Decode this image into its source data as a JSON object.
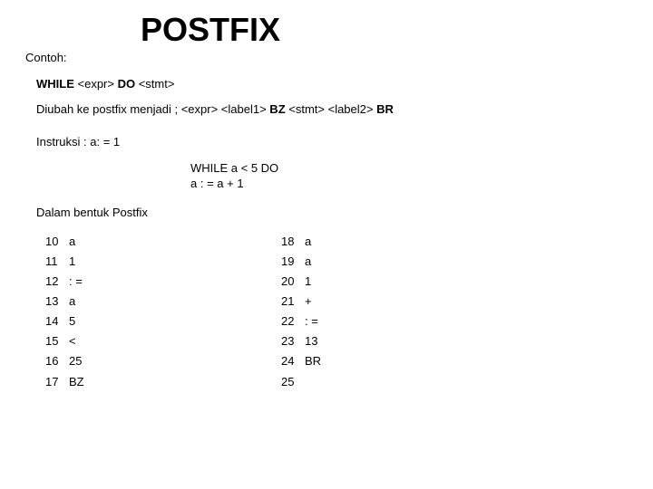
{
  "title": "POSTFIX",
  "contoh_label": "Contoh:",
  "line_while": {
    "pre": "WHILE",
    "mid": " <expr> ",
    "do": "DO",
    "post": " <stmt>"
  },
  "line_transform": {
    "prefix": "Diubah ke postfix menjadi ;",
    "spacer": "    ",
    "part1": "<expr>  <label1>",
    "bz": " BZ ",
    "part2": "<stmt> <label2>",
    "br": " BR"
  },
  "instruksi_label": "Instruksi :  a: = 1",
  "code1": "WHILE a < 5 DO",
  "code2": "   a : = a + 1",
  "dalam_label": "Dalam bentuk Postfix",
  "left": {
    "nums": [
      "10",
      "11",
      "12",
      "13",
      "14",
      "15",
      "16",
      "17"
    ],
    "toks": [
      "a",
      "1",
      ": =",
      "a",
      "5",
      "<",
      " 25",
      "BZ"
    ]
  },
  "right": {
    "nums": [
      "18",
      "19",
      "20",
      "21",
      "22",
      "23",
      "24",
      "25"
    ],
    "toks": [
      "a",
      "a",
      "1",
      "+",
      ": =",
      " 13",
      "BR",
      ""
    ]
  }
}
